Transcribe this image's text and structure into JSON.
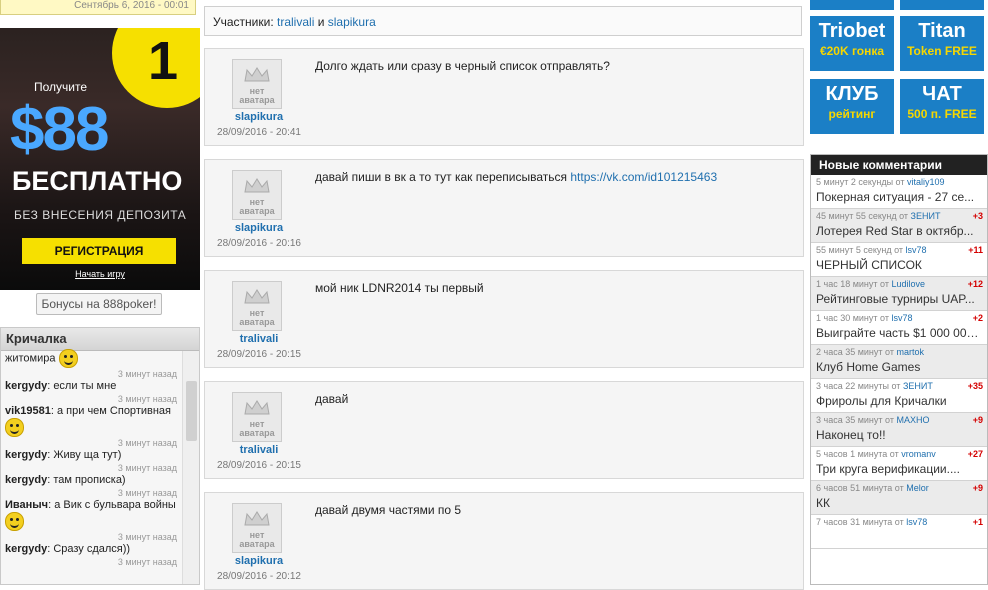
{
  "top_date": "Сентябрь 6, 2016 - 00:01",
  "banner": {
    "number": "1",
    "get": "Получите",
    "amount": "$88",
    "free": "БЕСПЛАТНО",
    "no_deposit": "БЕЗ ВНЕСЕНИЯ ДЕПОЗИТА",
    "register": "РЕГИСТРАЦИЯ",
    "play": "Начать игру"
  },
  "bonus_button": "Бонусы на 888poker!",
  "shoutbox": {
    "title": "Кричалка",
    "messages": [
      {
        "nick": "",
        "text": "житомира",
        "time": "3 минут назад"
      },
      {
        "nick": "kergydy",
        "text": ": если ты мне",
        "time": "3 минут назад"
      },
      {
        "nick": "vik19581",
        "text": ": а при чем Спортивная",
        "time": "3 минут назад"
      },
      {
        "nick": "kergydy",
        "text": ": Живу ща тут)",
        "time": "3 минут назад"
      },
      {
        "nick": "kergydy",
        "text": ": там прописка)",
        "time": "3 минут назад"
      },
      {
        "nick": "Иваныч",
        "text": ": а Вик с бульвара войны",
        "time": "3 минут назад"
      },
      {
        "nick": "kergydy",
        "text": ": Сразу сдался))",
        "time": "3 минут назад"
      }
    ]
  },
  "participants": {
    "label": "Участники:",
    "user1": "tralivali",
    "and": "и",
    "user2": "slapikura"
  },
  "avatar_text": "нет аватара",
  "posts": [
    {
      "author": "slapikura",
      "date": "28/09/2016 - 20:41",
      "text": "Долго ждать или сразу в черный список отправлять?",
      "link": ""
    },
    {
      "author": "slapikura",
      "date": "28/09/2016 - 20:16",
      "text": "давай пиши в вк а то тут как переписываться",
      "link": "https://vk.com/id101215463"
    },
    {
      "author": "tralivali",
      "date": "28/09/2016 - 20:15",
      "text": "мой ник LDNR2014 ты первый",
      "link": ""
    },
    {
      "author": "tralivali",
      "date": "28/09/2016 - 20:15",
      "text": "давай",
      "link": ""
    },
    {
      "author": "slapikura",
      "date": "28/09/2016 - 20:12",
      "text": "давай двумя частями по 5",
      "link": ""
    }
  ],
  "tiles": [
    {
      "title": "Triobet",
      "sub": "€20K гонка"
    },
    {
      "title": "Titan",
      "sub": "Token FREE"
    },
    {
      "title": "КЛУБ",
      "sub": "рейтинг"
    },
    {
      "title": "ЧАТ",
      "sub": "500 п. FREE"
    }
  ],
  "comments": {
    "title": "Новые комментарии",
    "items": [
      {
        "meta": "5 минут 2 секунды от",
        "user": "vitaliy109",
        "delta": "",
        "title": "Покерная ситуация - 27 се..."
      },
      {
        "meta": "45 минут 55 секунд от",
        "user": "ЗЕНИТ",
        "delta": "+3",
        "title": "Лотерея Red Star в октябр..."
      },
      {
        "meta": "55 минут 5 секунд от",
        "user": "lsv78",
        "delta": "+11",
        "title": "ЧЕРНЫЙ СПИСОК"
      },
      {
        "meta": "1 час 18 минут от",
        "user": "Ludilove",
        "delta": "+12",
        "title": "Рейтинговые турниры UAP..."
      },
      {
        "meta": "1 час 30 минут от",
        "user": "lsv78",
        "delta": "+2",
        "title": "Выиграйте часть $1 000 000..."
      },
      {
        "meta": "2 часа 35 минут от",
        "user": "martok",
        "delta": "",
        "title": "Клуб Home Games"
      },
      {
        "meta": "3 часа 22 минуты от",
        "user": "ЗЕНИТ",
        "delta": "+35",
        "title": "Фриролы для Кричалки"
      },
      {
        "meta": "3 часа 35 минут от",
        "user": "МАХНО",
        "delta": "+9",
        "title": "Наконец то!!"
      },
      {
        "meta": "5 часов 1 минута от",
        "user": "vromanv",
        "delta": "+27",
        "title": "Три круга верификации...."
      },
      {
        "meta": "6 часов 51 минута от",
        "user": "Melor",
        "delta": "+9",
        "title": "КК"
      },
      {
        "meta": "7 часов 31 минута от",
        "user": "lsv78",
        "delta": "+1",
        "title": ""
      }
    ]
  },
  "colors": {
    "accent_blue": "#1b7fc6",
    "link": "#1f6fae",
    "promo_yellow": "#f6e000",
    "delta_red": "#d40000"
  }
}
